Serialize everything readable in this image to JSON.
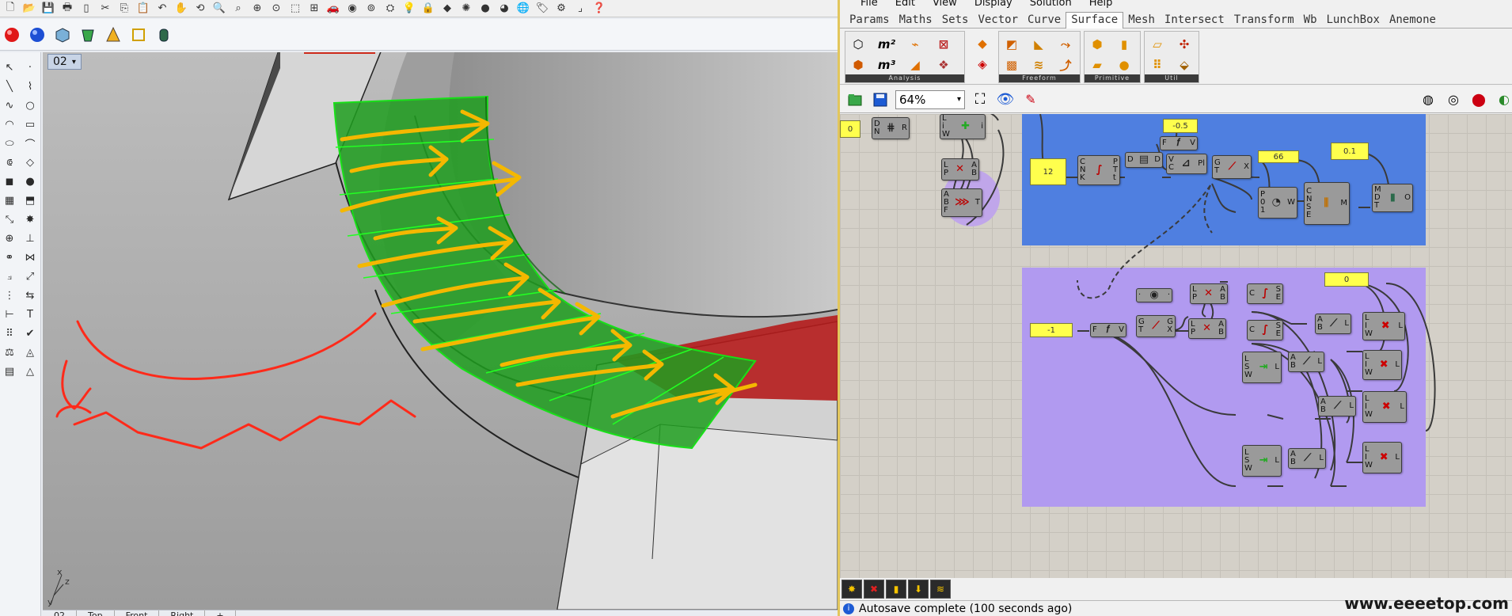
{
  "rhino": {
    "viewport_name": "02",
    "viewport_tabs": [
      "02",
      "Top",
      "Front",
      "Right",
      "+"
    ],
    "axes": {
      "x": "x",
      "y": "y",
      "z": "z"
    }
  },
  "gh": {
    "menu": [
      "File",
      "Edit",
      "View",
      "Display",
      "Solution",
      "Help"
    ],
    "tabs": [
      {
        "label": "Params",
        "active": false
      },
      {
        "label": "Maths",
        "active": false
      },
      {
        "label": "Sets",
        "active": false
      },
      {
        "label": "Vector",
        "active": false
      },
      {
        "label": "Curve",
        "active": false
      },
      {
        "label": "Surface",
        "active": true
      },
      {
        "label": "Mesh",
        "active": false
      },
      {
        "label": "Intersect",
        "active": false
      },
      {
        "label": "Transform",
        "active": false
      },
      {
        "label": "Wb",
        "active": false
      },
      {
        "label": "LunchBox",
        "active": false
      },
      {
        "label": "Anemone",
        "active": false
      }
    ],
    "ribbon_groups": [
      "Analysis",
      "Freeform",
      "Primitive",
      "Util"
    ],
    "zoom": "64%",
    "status": "Autosave complete (100 seconds ago)",
    "panels": {
      "p0": "0",
      "p_neg05": "-0.5",
      "p12": "12",
      "p66": "66",
      "p01": "0.1",
      "p0b": "0",
      "pneg1": "-1"
    },
    "watermark": "www.eeeetop.com",
    "colors": {
      "group_blue": "#4f7fe0",
      "group_purple": "#b19af0",
      "panel_yellow": "#ffff4d",
      "surface_green": "#2fb52f",
      "arrow_orange": "#f2b400",
      "sketch_red": "#ff2a1a"
    }
  }
}
